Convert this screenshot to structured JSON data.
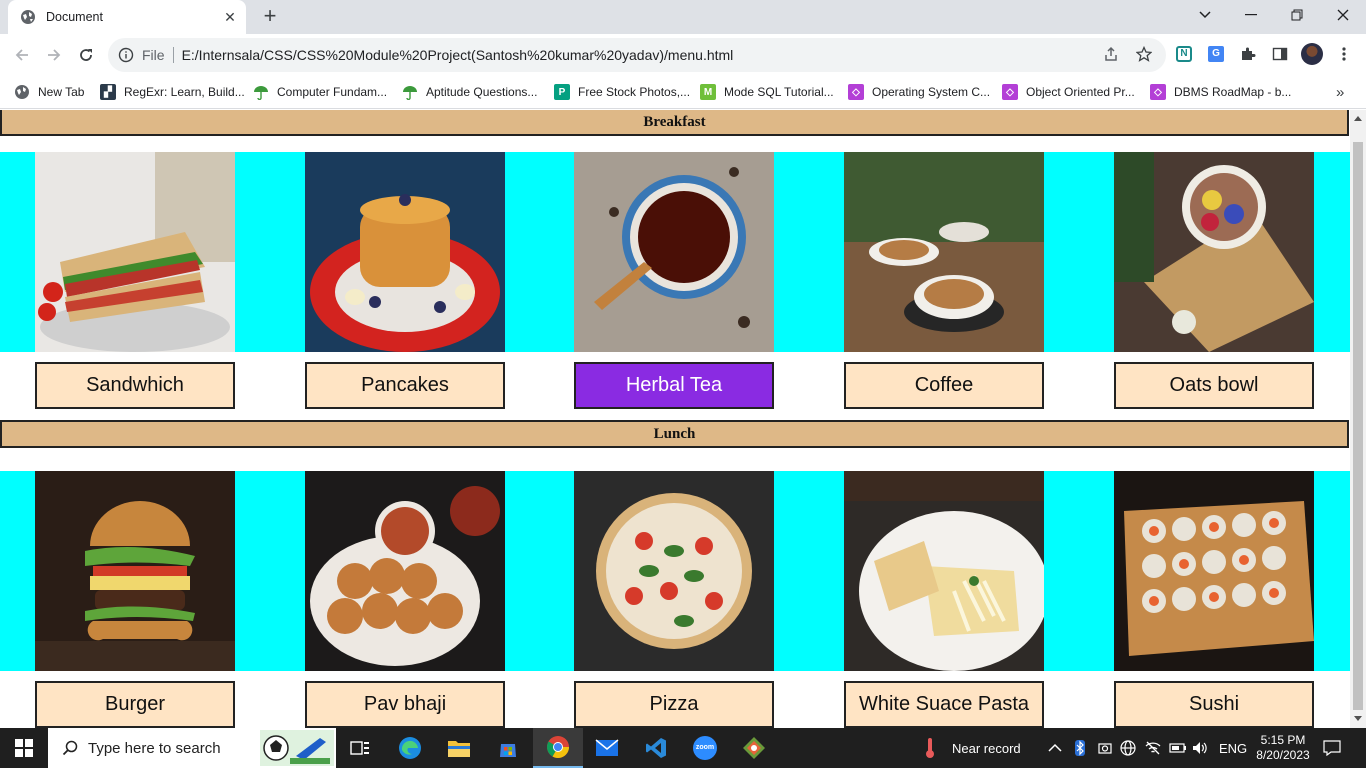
{
  "browser": {
    "tab_title": "Document",
    "url_scheme": "File",
    "url": "E:/Internsala/CSS/CSS%20Module%20Project(Santosh%20kumar%20yadav)/menu.html"
  },
  "bookmarks": [
    {
      "label": "New Tab",
      "icon": "globe-icon",
      "color": "#5f6368"
    },
    {
      "label": "RegExr: Learn, Build...",
      "icon": "regexr-icon",
      "color": "#2b3a4a"
    },
    {
      "label": "Computer Fundam...",
      "icon": "umbrella-icon",
      "color": "#3c9a3c"
    },
    {
      "label": "Aptitude Questions...",
      "icon": "umbrella-icon",
      "color": "#3c9a3c"
    },
    {
      "label": "Free Stock Photos,...",
      "icon": "pexels-icon",
      "color": "#05a081"
    },
    {
      "label": "Mode SQL Tutorial...",
      "icon": "mode-icon",
      "color": "#6fbf3a"
    },
    {
      "label": "Operating System C...",
      "icon": "scaler-icon",
      "color": "#b33fd6"
    },
    {
      "label": "Object Oriented Pr...",
      "icon": "scaler-icon",
      "color": "#b33fd6"
    },
    {
      "label": "DBMS RoadMap - b...",
      "icon": "scaler-icon",
      "color": "#b33fd6"
    }
  ],
  "menu": {
    "sections": [
      {
        "title": "Breakfast",
        "items": [
          {
            "label": "Sandwhich",
            "photo": "sandwich-photo"
          },
          {
            "label": "Pancakes",
            "photo": "pancakes-photo"
          },
          {
            "label": "Herbal Tea",
            "photo": "herbal-tea-photo",
            "hovered": true
          },
          {
            "label": "Coffee",
            "photo": "coffee-photo"
          },
          {
            "label": "Oats bowl",
            "photo": "oats-bowl-photo"
          }
        ]
      },
      {
        "title": "Lunch",
        "items": [
          {
            "label": "Burger",
            "photo": "burger-photo"
          },
          {
            "label": "Pav bhaji",
            "photo": "pav-bhaji-photo"
          },
          {
            "label": "Pizza",
            "photo": "pizza-photo"
          },
          {
            "label": "White Suace Pasta",
            "photo": "pasta-photo"
          },
          {
            "label": "Sushi",
            "photo": "sushi-photo"
          }
        ]
      }
    ],
    "colors": {
      "heading_bg": "#deb887",
      "band_bg": "#00ffff",
      "button_bg": "#ffe4c4",
      "button_active_bg": "#8a2be2"
    }
  },
  "taskbar": {
    "search_placeholder": "Type here to search",
    "weather_text": "Near record",
    "language": "ENG",
    "time": "5:15 PM",
    "date": "8/20/2023"
  }
}
